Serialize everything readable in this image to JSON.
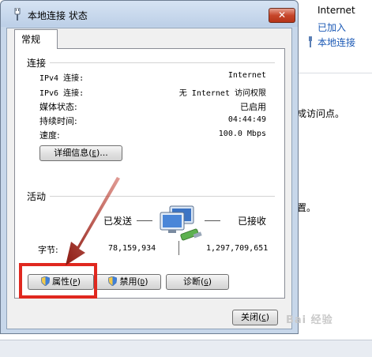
{
  "background": {
    "internet_label": "Internet",
    "joined_label": "已加入",
    "local_conn_link": "本地连接",
    "partial_text_1": "成访问点。",
    "partial_text_2": "置。"
  },
  "dialog": {
    "title": "本地连接 状态",
    "close_glyph": "✕",
    "tab_label": "常规",
    "connection_section": "连接",
    "rows": [
      {
        "label": "IPv4 连接:",
        "value": "Internet"
      },
      {
        "label": "IPv6 连接:",
        "value": "无 Internet 访问权限"
      },
      {
        "label": "媒体状态:",
        "value": "已启用"
      },
      {
        "label": "持续时间:",
        "value": "04:44:49"
      },
      {
        "label": "速度:",
        "value": "100.0 Mbps"
      }
    ],
    "details_button": "详细信息",
    "details_key": "E",
    "activity_section": "活动",
    "sent_label": "已发送",
    "received_label": "已接收",
    "bytes_label": "字节:",
    "bytes_sent": "78,159,934",
    "bytes_received": "1,297,709,651",
    "properties_button": "属性",
    "properties_key": "P",
    "disable_button": "禁用",
    "disable_key": "D",
    "diagnose_button": "诊断",
    "diagnose_key": "G",
    "close_button": "关闭",
    "close_key": "C"
  },
  "watermark": "Bai 经验",
  "colors": {
    "highlight": "#e0281f",
    "arrow": "#8b1a12",
    "link": "#1b59b5"
  }
}
